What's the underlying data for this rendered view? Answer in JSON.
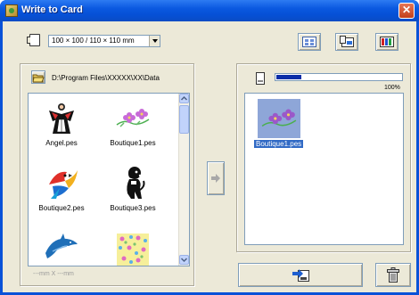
{
  "window": {
    "title": "Write to Card"
  },
  "toolbar": {
    "card_size": "100 × 100 / 110 × 110 mm",
    "buttons": [
      "layout-icon",
      "card-write-icon",
      "color-table-icon"
    ]
  },
  "left_panel": {
    "path": "D:\\Program Files\\XXXXX\\XX\\Data",
    "files": [
      {
        "name": "Angel.pes",
        "icon": "angel-embroidery"
      },
      {
        "name": "Boutique1.pes",
        "icon": "flowers-embroidery"
      },
      {
        "name": "Boutique2.pes",
        "icon": "parrot-embroidery"
      },
      {
        "name": "Boutique3.pes",
        "icon": "dog-embroidery"
      },
      {
        "name": "",
        "icon": "dolphin-embroidery"
      },
      {
        "name": "",
        "icon": "floral-pattern-embroidery"
      }
    ],
    "size_readout": "---mm X ---mm"
  },
  "transfer": {
    "icon": "right-arrow-icon"
  },
  "right_panel": {
    "progress": 0.2,
    "progress_label": "100%",
    "files": [
      {
        "name": "Boutique1.pes",
        "selected": true
      }
    ]
  },
  "bottom": {
    "icons": [
      "write-to-card-icon",
      "delete-icon"
    ]
  }
}
